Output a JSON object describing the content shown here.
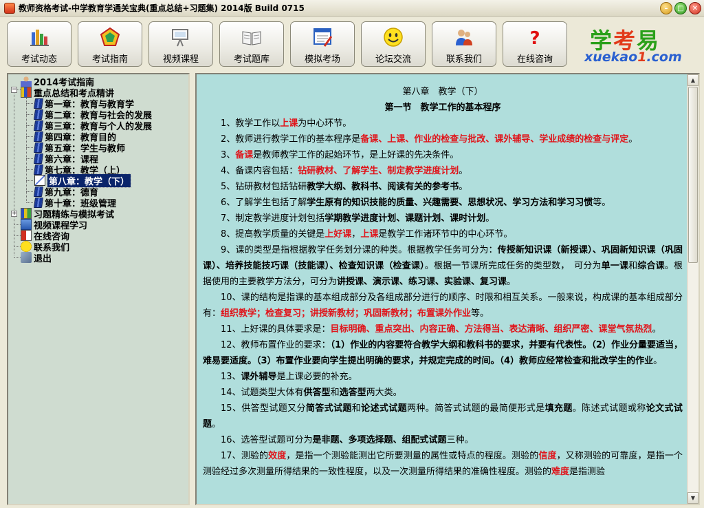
{
  "window": {
    "title": "教师资格考试-中学教育学通关宝典(重点总结+习题集) 2014版 Build 0715"
  },
  "toolbar": {
    "buttons": [
      {
        "label": "考试动态",
        "icon": "books-chart-icon"
      },
      {
        "label": "考试指南",
        "icon": "pentagon-icon"
      },
      {
        "label": "视频课程",
        "icon": "projector-icon"
      },
      {
        "label": "考试题库",
        "icon": "open-book-icon"
      },
      {
        "label": "模拟考场",
        "icon": "exam-paper-icon"
      },
      {
        "label": "论坛交流",
        "icon": "smiley-icon"
      },
      {
        "label": "联系我们",
        "icon": "users-icon"
      },
      {
        "label": "在线咨询",
        "icon": "question-icon"
      }
    ]
  },
  "logo": {
    "cn1": "学",
    "cn2": "考",
    "cn3": "易",
    "en1": "xuekao",
    "en2": "1",
    "en3": ".com"
  },
  "tree": {
    "items": [
      {
        "label": "2014考试指南"
      },
      {
        "label": "重点总结和考点精讲"
      },
      {
        "label": "第一章：教育与教育学"
      },
      {
        "label": "第二章：教育与社会的发展"
      },
      {
        "label": "第三章：教育与个人的发展"
      },
      {
        "label": "第四章：教育目的"
      },
      {
        "label": "第五章：学生与教师"
      },
      {
        "label": "第六章：课程"
      },
      {
        "label": "第七章：教学（上）"
      },
      {
        "label": "第八章：教学（下）"
      },
      {
        "label": "第九章：德育"
      },
      {
        "label": "第十章：班级管理"
      },
      {
        "label": "习题精练与模拟考试"
      },
      {
        "label": "视频课程学习"
      },
      {
        "label": "在线咨询"
      },
      {
        "label": "联系我们"
      },
      {
        "label": "退出"
      }
    ],
    "selected": "第八章：教学（下）"
  },
  "content": {
    "chapter": "第八章　教学（下）",
    "section": "第一节　教学工作的基本程序",
    "p1": {
      "a": "1、教学工作以",
      "b": "上课",
      "c": "为中心环节。"
    },
    "p2": {
      "a": "2、教师进行教学工作的基本程序是",
      "b": "备课、上课、作业的检查与批改、课外辅导、学业成绩的检查与评定",
      "c": "。"
    },
    "p3": {
      "a": "3、",
      "b": "备课",
      "c": "是教师教学工作的起始环节，是上好课的先决条件。"
    },
    "p4": {
      "a": "4、备课内容包括：",
      "b": "钻研教材、了解学生、制定教学进度计划",
      "c": "。"
    },
    "p5": {
      "a": "5、钻研教材包括钻研",
      "b": "教学大纲、教科书、阅读有关的参考书",
      "c": "。"
    },
    "p6": {
      "a": "6、了解学生包括了解",
      "b": "学生原有的知识技能的质量、兴趣需要、思想状况、学习方法和学习习惯",
      "c": "等。"
    },
    "p7": {
      "a": "7、制定教学进度计划包括",
      "b": "学期教学进度计划、课题计划、课时计划",
      "c": "。"
    },
    "p8": {
      "a": "8、提高教学质量的关键是",
      "b": "上好课",
      "c": "，",
      "d": "上课",
      "e": "是教学工作诸环节中的中心环节。"
    },
    "p9": {
      "a": "9、课的类型是指根据教学任务划分课的种类。根据教学任务可分为：",
      "b": "传授新知识课（新授课）、巩固新知识课（巩固课）、培养技能技巧课（技能课）、检查知识课（检查课）",
      "c": "。根据一节课所完成任务的类型数，　可分为",
      "d": "单一课",
      "e": "和",
      "f": "综合课",
      "g": "。根据使用的主要教学方法分，可分为",
      "h": "讲授课、演示课、练习课、实验课、复习课",
      "i": "。"
    },
    "p10": {
      "a": "10、课的结构是指课的基本组成部分及各组成部分进行的顺序、时限和相互关系。一般来说，构成课的基本组成部分有：",
      "b": "组织教学；检查复习；讲授新教材；巩固新教材；布置课外作业",
      "c": "等。"
    },
    "p11": {
      "a": "11、上好课的具体要求是：",
      "b": "目标明确、重点突出、内容正确、方法得当、表达清晰、组织严密、课堂气氛热烈",
      "c": "。"
    },
    "p12": {
      "a": "12、教师布置作业的要求：",
      "b": "（1）作业的内容要符合教学大纲和教科书的要求，并要有代表性。（2）作业分量要适当，难易要适度。（3）布置作业要向学生提出明确的要求，并规定完成的时间。（4）教师应经常检查和批改学生的作业",
      "c": "。"
    },
    "p13": {
      "a": "13、",
      "b": "课外辅导",
      "c": "是上课必要的补充。"
    },
    "p14": {
      "a": "14、试题类型大体有",
      "b": "供答型",
      "c": "和",
      "d": "选答型",
      "e": "两大类。"
    },
    "p15": {
      "a": "15、供答型试题又分",
      "b": "简答式试题",
      "c": "和",
      "d": "论述式试题",
      "e": "两种。简答式试题的最简便形式是",
      "f": "填充题",
      "g": "。陈述式试题或称",
      "h": "论文式试题",
      "i": "。"
    },
    "p16": {
      "a": "16、选答型试题可分为",
      "b": "是非题、多项选择题、组配式试题",
      "c": "三种。"
    },
    "p17": {
      "a": "17、测验的",
      "b": "效度",
      "c": "，是指一个测验能测出它所要测量的属性或特点的程度。测验的",
      "d": "信度",
      "e": "，又称测验的可靠度，是指一个测验经过多次测量所得结果的一致性程度，以及一次测量所得结果的准确性程度。测验的",
      "f": "难度",
      "g": "是指测验"
    }
  },
  "colors": {
    "accent_red": "#e0141a",
    "content_bg": "#b0dedc",
    "tree_bg": "#cfdcd0"
  }
}
